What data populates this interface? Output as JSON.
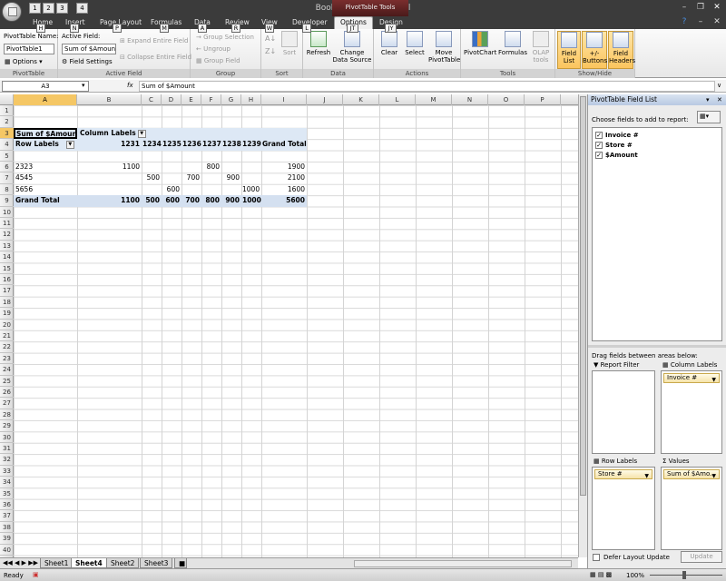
{
  "window": {
    "title": "Book1 - Microsoft Excel",
    "context_tab": "PivotTable Tools"
  },
  "qat_keys": [
    "1",
    "2",
    "3",
    "4"
  ],
  "tabs": [
    "Home",
    "Insert",
    "Page Layout",
    "Formulas",
    "Data",
    "Review",
    "View",
    "Developer",
    "Options",
    "Design"
  ],
  "tab_keys": [
    "H",
    "N",
    "P",
    "M",
    "A",
    "R",
    "W",
    "L",
    "JT",
    "JY"
  ],
  "ribbon": {
    "pivottable": {
      "label": "PivotTable Name:",
      "name": "PivotTable1",
      "options": "Options",
      "group": "PivotTable"
    },
    "active_field": {
      "label": "Active Field:",
      "value": "Sum of $Amount",
      "settings": "Field Settings",
      "expand": "Expand Entire Field",
      "collapse": "Collapse Entire Field",
      "group": "Active Field"
    },
    "group": {
      "selection": "Group Selection",
      "ungroup": "Ungroup",
      "field": "Group Field",
      "group": "Group"
    },
    "sort": {
      "sort": "Sort",
      "group": "Sort"
    },
    "data": {
      "refresh": "Refresh",
      "change": "Change Data Source",
      "group": "Data"
    },
    "actions": {
      "clear": "Clear",
      "select": "Select",
      "move": "Move PivotTable",
      "group": "Actions"
    },
    "tools": {
      "chart": "PivotChart",
      "formulas": "Formulas",
      "olap": "OLAP tools",
      "group": "Tools"
    },
    "showhide": {
      "list": "Field List",
      "buttons": "+/- Buttons",
      "headers": "Field Headers",
      "group": "Show/Hide"
    }
  },
  "formula_bar": {
    "namebox": "A3",
    "fx": "fx",
    "content": "Sum of $Amount"
  },
  "columns": [
    "A",
    "B",
    "C",
    "D",
    "E",
    "F",
    "G",
    "H",
    "I",
    "J",
    "K",
    "L",
    "M",
    "N",
    "O",
    "P"
  ],
  "pivot": {
    "header": "Sum of $Amount",
    "col_labels": "Column Labels",
    "row_labels": "Row Labels",
    "grand_total": "Grand Total",
    "col_keys": [
      "1231",
      "1234",
      "1235",
      "1236",
      "1237",
      "1238",
      "1239"
    ],
    "rows": [
      {
        "label": "2323",
        "values": [
          "1100",
          "",
          "",
          "",
          "800",
          "",
          ""
        ],
        "total": "1900"
      },
      {
        "label": "4545",
        "values": [
          "",
          "500",
          "",
          "700",
          "",
          "900",
          ""
        ],
        "total": "2100"
      },
      {
        "label": "5656",
        "values": [
          "",
          "",
          "600",
          "",
          "",
          "",
          "1000"
        ],
        "total": "1600"
      }
    ],
    "totals": [
      "1100",
      "500",
      "600",
      "700",
      "800",
      "900",
      "1000"
    ],
    "grand": "5600"
  },
  "sheets": [
    "Sheet1",
    "Sheet4",
    "Sheet2",
    "Sheet3"
  ],
  "active_sheet": "Sheet4",
  "status": {
    "ready": "Ready",
    "zoom": "100%"
  },
  "field_list": {
    "title": "PivotTable Field List",
    "choose": "Choose fields to add to report:",
    "fields": [
      "Invoice #",
      "Store #",
      "$Amount"
    ],
    "drag": "Drag fields between areas below:",
    "report_filter": "Report Filter",
    "column_labels": "Column Labels",
    "row_labels": "Row Labels",
    "values": "Values",
    "col_field": "Invoice #",
    "row_field": "Store #",
    "val_field": "Sum of $Amo...",
    "defer": "Defer Layout Update",
    "update": "Update"
  }
}
